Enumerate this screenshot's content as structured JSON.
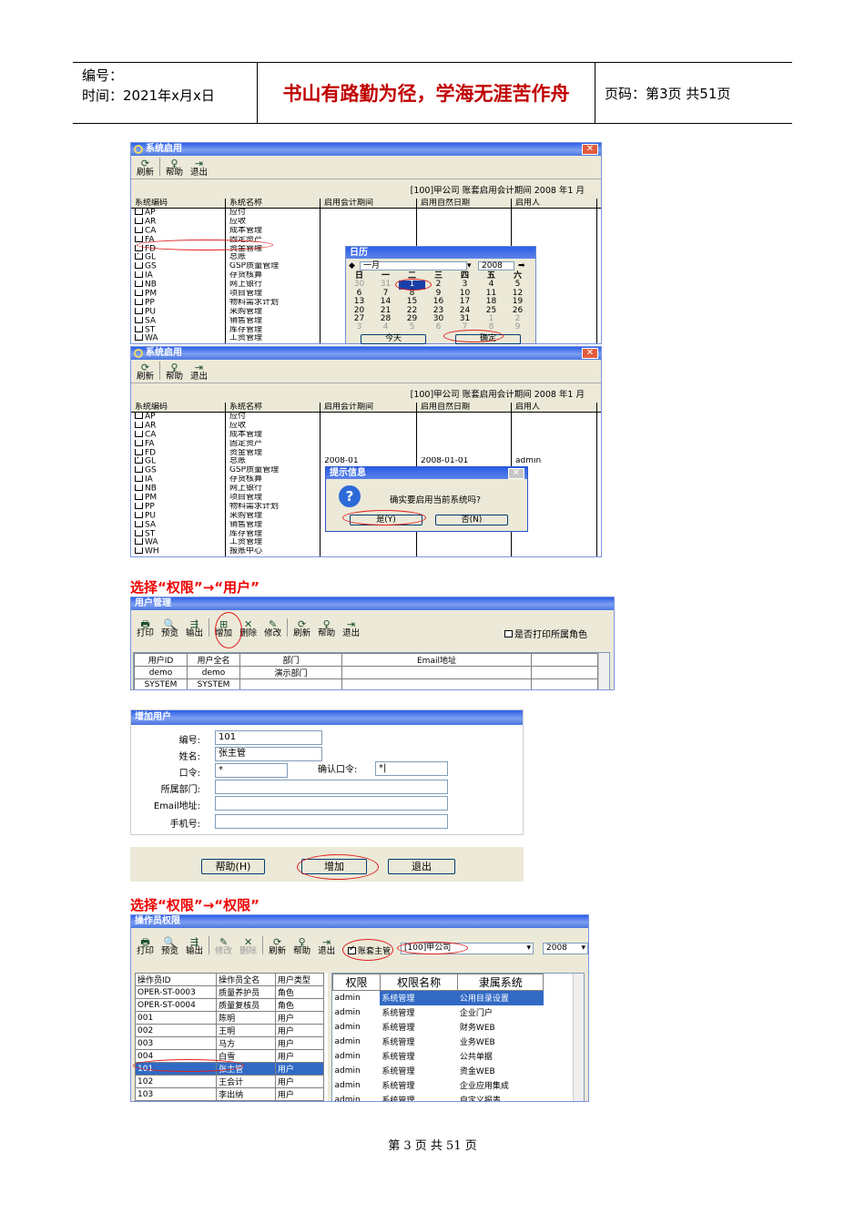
{
  "header": {
    "doc_no_label": "编号：",
    "time_label": "时间：2021年x月x日",
    "motto": "书山有路勤为径，学海无涯苦作舟",
    "page_label": "页码：第3页  共51页"
  },
  "footer": {
    "page": "第 3 页 共 51 页"
  },
  "win1": {
    "title": "系统启用",
    "close": "✕",
    "toolbar": {
      "refresh": "刷新",
      "help": "帮助",
      "exit": "退出"
    },
    "info": "[100]甲公司 账套启用会计期间 2008 年1 月",
    "cols": [
      "系统编码",
      "系统名称",
      "启用会计期间",
      "启用自然日期",
      "启用人"
    ],
    "rows": [
      [
        "AP",
        "应付"
      ],
      [
        "AR",
        "应收"
      ],
      [
        "CA",
        "成本管理"
      ],
      [
        "FA",
        "固定资产"
      ],
      [
        "FD",
        "资金管理"
      ],
      [
        "GL",
        "总账"
      ],
      [
        "GS",
        "GSP质量管理"
      ],
      [
        "IA",
        "存货核算"
      ],
      [
        "NB",
        "网上银行"
      ],
      [
        "PM",
        "项目管理"
      ],
      [
        "PP",
        "物料需求计划"
      ],
      [
        "PU",
        "采购管理"
      ],
      [
        "SA",
        "销售管理"
      ],
      [
        "ST",
        "库存管理"
      ],
      [
        "WA",
        "工资管理"
      ],
      [
        "WH",
        "报账中心"
      ]
    ]
  },
  "calendar": {
    "title": "日历",
    "month": "一月",
    "year": "2008",
    "prev": "◆",
    "next": "➡",
    "weekdays": [
      "日",
      "一",
      "二",
      "三",
      "四",
      "五",
      "六"
    ],
    "weeks": [
      [
        "30",
        "31",
        "1",
        "2",
        "3",
        "4",
        "5"
      ],
      [
        "6",
        "7",
        "8",
        "9",
        "10",
        "11",
        "12"
      ],
      [
        "13",
        "14",
        "15",
        "16",
        "17",
        "18",
        "19"
      ],
      [
        "20",
        "21",
        "22",
        "23",
        "24",
        "25",
        "26"
      ],
      [
        "27",
        "28",
        "29",
        "30",
        "31",
        "1",
        "2"
      ],
      [
        "3",
        "4",
        "5",
        "6",
        "7",
        "8",
        "9"
      ]
    ],
    "today": "今天",
    "ok": "确定"
  },
  "win2": {
    "title": "系统启用",
    "close": "✕",
    "toolbar": {
      "refresh": "刷新",
      "help": "帮助",
      "exit": "退出"
    },
    "info": "[100]甲公司 账套启用会计期间 2008 年1 月",
    "gl_period": "2008-01",
    "gl_date": "2008-01-01",
    "gl_user": "admin"
  },
  "msgbox": {
    "title": "提示信息",
    "text": "确实要启用当前系统吗?",
    "yes": "是(Y)",
    "no": "否(N)",
    "close": "✕"
  },
  "sec1": "选择“权限”→“用户”",
  "usermgmt": {
    "title": "用户管理",
    "toolbar": [
      "打印",
      "预览",
      "输出",
      "增加",
      "删除",
      "修改",
      "刷新",
      "帮助",
      "退出"
    ],
    "print_roles": "是否打印所属角色",
    "cols": [
      "用户ID",
      "用户全名",
      "部门",
      "Email地址"
    ],
    "rows": [
      [
        "demo",
        "demo",
        "演示部门",
        ""
      ],
      [
        "SYSTEM",
        "SYSTEM",
        "",
        ""
      ]
    ]
  },
  "adduser": {
    "title": "增加用户",
    "labels": [
      "编号:",
      "姓名:",
      "口令:",
      "所属部门:",
      "Email地址:",
      "手机号:"
    ],
    "values": [
      "101",
      "张主管",
      "*",
      "",
      "",
      ""
    ],
    "confirm_label": "确认口令:",
    "confirm_value": "*|",
    "help": "帮助(H)",
    "add": "增加",
    "exit": "退出"
  },
  "sec2": "选择“权限”→“权限”",
  "perm": {
    "title": "操作员权限",
    "toolbar": [
      "打印",
      "预览",
      "输出",
      "修改",
      "删除",
      "刷新",
      "帮助",
      "退出"
    ],
    "supervisor": "账套主管",
    "company": "[100]甲公司",
    "year": "2008",
    "left_cols": [
      "操作员ID",
      "操作员全名",
      "用户类型"
    ],
    "left_rows": [
      [
        "OPER-ST-0003",
        "质量养护员",
        "角色"
      ],
      [
        "OPER-ST-0004",
        "质量复核员",
        "角色"
      ],
      [
        "001",
        "陈明",
        "用户"
      ],
      [
        "002",
        "王明",
        "用户"
      ],
      [
        "003",
        "马方",
        "用户"
      ],
      [
        "004",
        "白雪",
        "用户"
      ],
      [
        "101",
        "张主管",
        "用户"
      ],
      [
        "102",
        "王会计",
        "用户"
      ],
      [
        "103",
        "李出纳",
        "用户"
      ]
    ],
    "right_cols": [
      "权限",
      "权限名称",
      "隶属系统"
    ],
    "right_rows": [
      [
        "admin",
        "系统管理",
        "公用目录设置"
      ],
      [
        "admin",
        "系统管理",
        "企业门户"
      ],
      [
        "admin",
        "系统管理",
        "财务WEB"
      ],
      [
        "admin",
        "系统管理",
        "业务WEB"
      ],
      [
        "admin",
        "系统管理",
        "公共单据"
      ],
      [
        "admin",
        "系统管理",
        "资金WEB"
      ],
      [
        "admin",
        "系统管理",
        "企业应用集成"
      ],
      [
        "admin",
        "系统管理",
        "自定义报表"
      ]
    ]
  }
}
